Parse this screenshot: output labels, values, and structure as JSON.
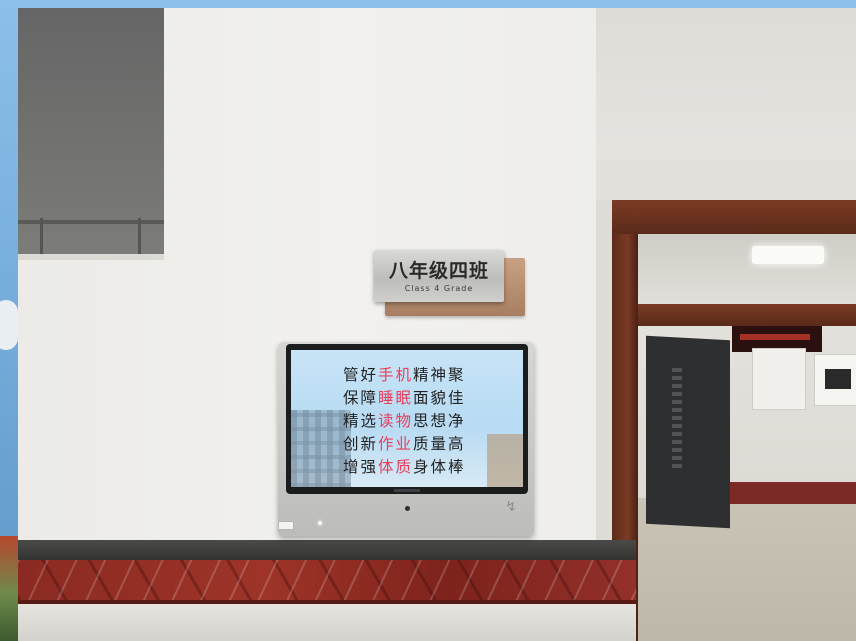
{
  "photo": {
    "description_colors": {
      "wall": "#efeeeb",
      "door_frame": "#6b3320",
      "marble": "#8f2c24",
      "screen_background": "#bfe0f5",
      "highlight": "#ea3e5b"
    }
  },
  "class_sign": {
    "title": "八年级四班",
    "subtitle": "Class 4  Grade"
  },
  "kiosk_screen": {
    "lines": [
      {
        "pre": "管好",
        "hl": "手机",
        "post": "精神聚"
      },
      {
        "pre": "保障",
        "hl": "睡眠",
        "post": "面貌佳"
      },
      {
        "pre": "精选",
        "hl": "读物",
        "post": "思想净"
      },
      {
        "pre": "创新",
        "hl": "作业",
        "post": "质量高"
      },
      {
        "pre": "增强",
        "hl": "体质",
        "post": "身体棒"
      }
    ]
  },
  "icons": {
    "nfc": "contactless-card-icon"
  }
}
